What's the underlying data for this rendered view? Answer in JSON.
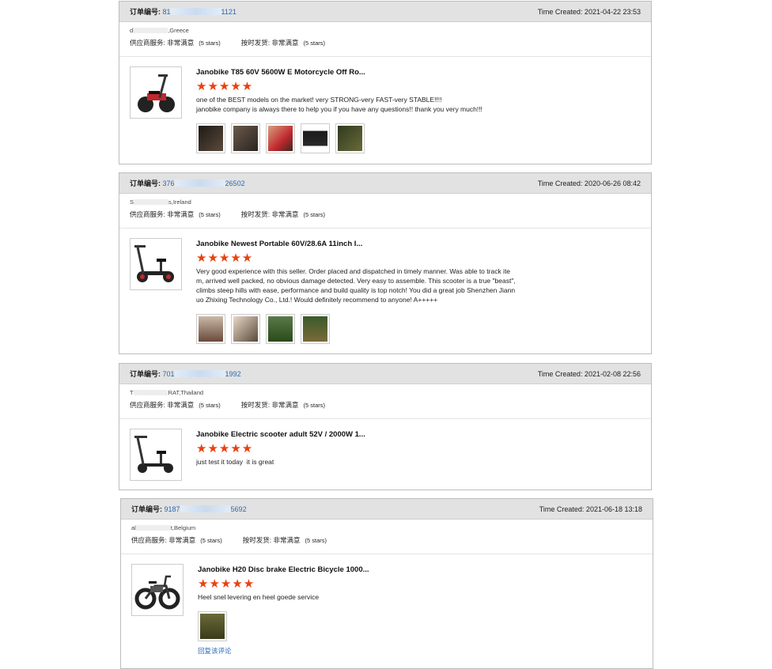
{
  "labels": {
    "order_label": "订单编号:",
    "supplier_service": "供应商服务:",
    "on_time_delivery": "按时发货:"
  },
  "reviews": [
    {
      "order_no_start": "81",
      "order_no_end": "1121",
      "time_created": "Time Created: 2021-04-22 23:53",
      "buyer_prefix": "d",
      "buyer_country": ",Greece",
      "service_value": "非常满意",
      "service_stars": "(5 stars)",
      "delivery_value": "非常满意",
      "delivery_stars": "(5 stars)",
      "product_title": "Janobike T85 60V 5600W E Motorcycle Off Ro...",
      "stars": "★★★★★",
      "review_text": "one of the BEST models on the market! very STRONG-very FAST-very STABLE!!!!\njanobike company is always there to help you if you have any questions!! thank you very much!!!",
      "photos": [
        "#3a2e26",
        "#5a4638",
        "#c26a4a",
        "#1e1e1e",
        "#4c4a30"
      ]
    },
    {
      "order_no_start": "376",
      "order_no_end": "26502",
      "time_created": "Time Created: 2020-06-26 08:42",
      "buyer_prefix": "S",
      "buyer_country": "s,Ireland",
      "service_value": "非常满意",
      "service_stars": "(5 stars)",
      "delivery_value": "非常满意",
      "delivery_stars": "(5 stars)",
      "product_title": "Janobike Newest Portable 60V/28.6A 11inch I...",
      "stars": "★★★★★",
      "review_text": "Very good experience with this seller. Order placed and dispatched in timely manner. Was able to track ite\nm, arrived well packed, no obvious damage detected. Very easy to assemble. This scooter is a true \"beast\",\nclimbs steep hills with ease, performance and build quality is top notch! You did a great job Shenzhen Jiann\nuo Zhixing Technology Co., Ltd.! Would definitely recommend to anyone! A+++++",
      "photos": [
        "#8a6a56",
        "#6a5a4a",
        "#3a5a2a",
        "#4a6a32"
      ]
    },
    {
      "order_no_start": "701",
      "order_no_end": "1992",
      "time_created": "Time Created: 2021-02-08 22:56",
      "buyer_prefix": "T",
      "buyer_country": "RAT,Thailand",
      "service_value": "非常满意",
      "service_stars": "(5 stars)",
      "delivery_value": "非常满意",
      "delivery_stars": "(5 stars)",
      "product_title": "Janobike Electric scooter adult 52V / 2000W 1...",
      "stars": "★★★★★",
      "review_text": "just test it today  it is great",
      "photos": []
    },
    {
      "order_no_start": "9187",
      "order_no_end": "5692",
      "time_created": "Time Created: 2021-06-18 13:18",
      "buyer_prefix": "al",
      "buyer_country": "t,Belgium",
      "service_value": "非常满意",
      "service_stars": "(5 stars)",
      "delivery_value": "非常满意",
      "delivery_stars": "(5 stars)",
      "product_title": "Janobike H20 Disc brake Electric Bicycle 1000...",
      "stars": "★★★★★",
      "review_text": "Heel snel levering en heel goede service",
      "photos": [
        "#4a4a2a"
      ],
      "reply_link": "回复该评论"
    }
  ]
}
